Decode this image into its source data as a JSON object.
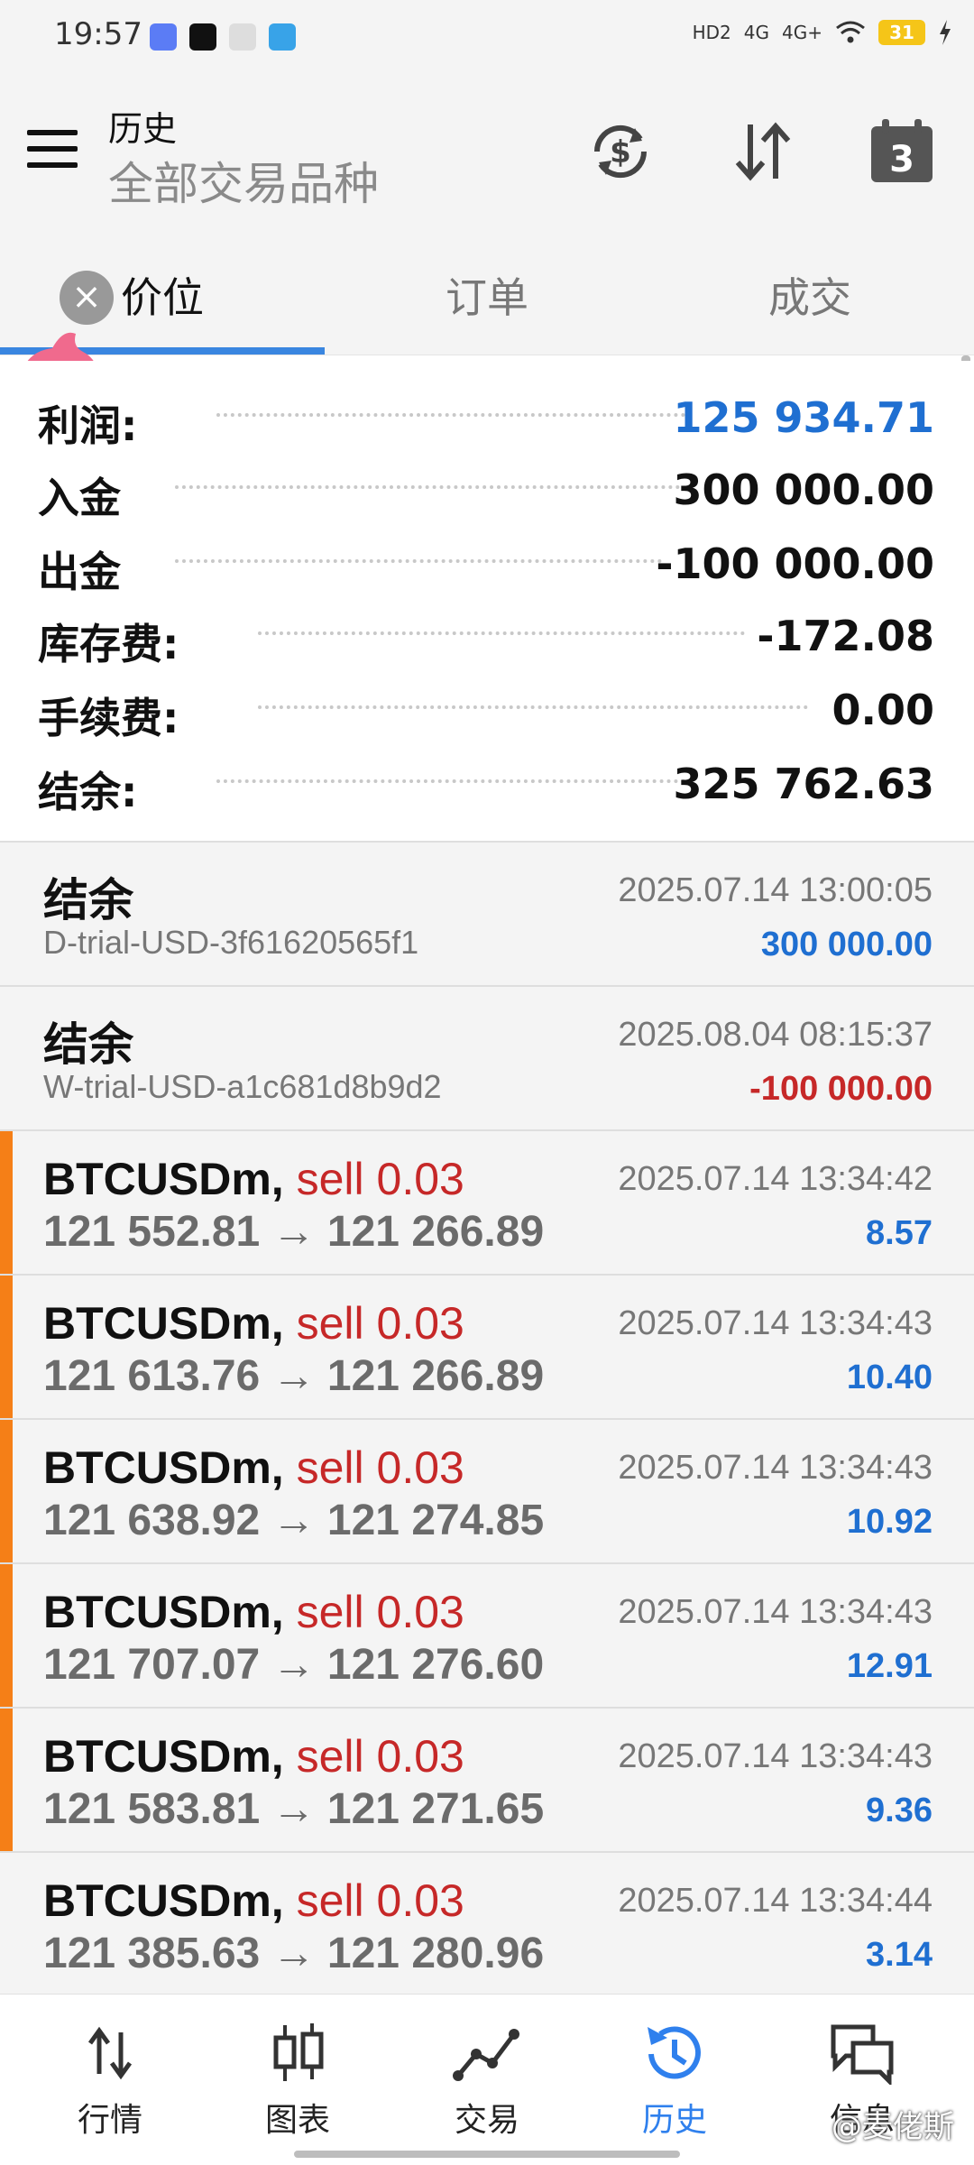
{
  "status_bar": {
    "time": "19:57",
    "network": [
      "HD2",
      "4G",
      "4G+"
    ],
    "battery": "31",
    "icons": [
      "browser-icon",
      "tiktok-icon",
      "wechat-icon",
      "map-app-icon",
      "wifi-icon",
      "signal-icon",
      "charging-icon"
    ]
  },
  "header": {
    "title": "历史",
    "subtitle": "全部交易品种",
    "calendar_badge": "3"
  },
  "tabs": [
    {
      "label": "价位",
      "active": true
    },
    {
      "label": "订单",
      "active": false
    },
    {
      "label": "成交",
      "active": false
    }
  ],
  "summary": [
    {
      "label": "利润:",
      "value": "125 934.71",
      "color": "#1f6fd1"
    },
    {
      "label": "入金",
      "value": "300 000.00",
      "color": "#111111"
    },
    {
      "label": "出金",
      "value": "-100 000.00",
      "color": "#111111"
    },
    {
      "label": "库存费:",
      "value": "-172.08",
      "color": "#111111"
    },
    {
      "label": "手续费:",
      "value": "0.00",
      "color": "#111111"
    },
    {
      "label": "结余:",
      "value": "325 762.63",
      "color": "#111111"
    }
  ],
  "balance_rows": [
    {
      "title": "结余",
      "id": "D-trial-USD-3f61620565f1",
      "time": "2025.07.14 13:00:05",
      "amount": "300 000.00"
    },
    {
      "title": "结余",
      "id": "W-trial-USD-a1c681d8b9d2",
      "time": "2025.08.04 08:15:37",
      "amount": "-100 000.00"
    }
  ],
  "trades": [
    {
      "symbol": "BTCUSDm,",
      "side": "sell 0.03",
      "prices": "121 552.81 → 121 266.89",
      "time": "2025.07.14 13:34:42",
      "profit": "8.57"
    },
    {
      "symbol": "BTCUSDm,",
      "side": "sell 0.03",
      "prices": "121 613.76 → 121 266.89",
      "time": "2025.07.14 13:34:43",
      "profit": "10.40"
    },
    {
      "symbol": "BTCUSDm,",
      "side": "sell 0.03",
      "prices": "121 638.92 → 121 274.85",
      "time": "2025.07.14 13:34:43",
      "profit": "10.92"
    },
    {
      "symbol": "BTCUSDm,",
      "side": "sell 0.03",
      "prices": "121 707.07 → 121 276.60",
      "time": "2025.07.14 13:34:43",
      "profit": "12.91"
    },
    {
      "symbol": "BTCUSDm,",
      "side": "sell 0.03",
      "prices": "121 583.81 → 121 271.65",
      "time": "2025.07.14 13:34:43",
      "profit": "9.36"
    },
    {
      "symbol": "BTCUSDm,",
      "side": "sell 0.03",
      "prices": "121 385.63 → 121 280.96",
      "time": "2025.07.14 13:34:44",
      "profit": "3.14"
    }
  ],
  "bottom_nav": [
    {
      "label": "行情",
      "icon": "quotes-arrows-icon",
      "active": false
    },
    {
      "label": "图表",
      "icon": "candlestick-chart-icon",
      "active": false
    },
    {
      "label": "交易",
      "icon": "trade-line-icon",
      "active": false
    },
    {
      "label": "历史",
      "icon": "history-clock-icon",
      "active": true
    },
    {
      "label": "信息",
      "icon": "messages-icon",
      "active": false
    }
  ],
  "watermark": "@麦佬斯",
  "colors": {
    "accent_blue": "#3a86e0",
    "profit_blue": "#1f6fd1",
    "sell_red": "#c62828",
    "trade_marker": "#f57f17"
  }
}
